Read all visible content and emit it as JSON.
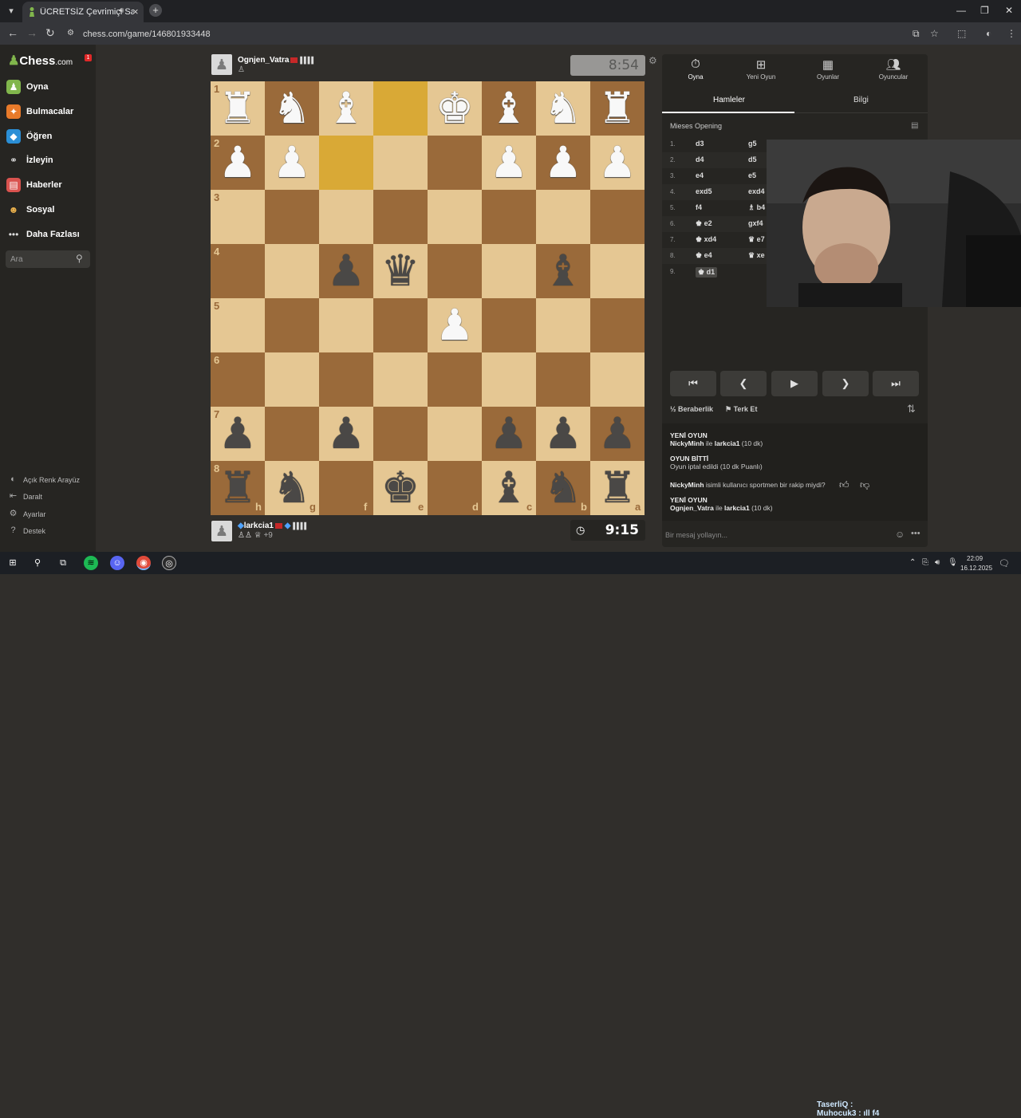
{
  "browser": {
    "tab_title": "ÜCRETSİZ Çevrimiçi Satranç",
    "url": "chess.com/game/146801933448"
  },
  "sidebar": {
    "logo": "Chess",
    "logo_suffix": ".com",
    "notification_count": "1",
    "items": [
      {
        "label": "Oyna",
        "icon": "play-icon"
      },
      {
        "label": "Bulmacalar",
        "icon": "puzzle-icon"
      },
      {
        "label": "Öğren",
        "icon": "learn-icon"
      },
      {
        "label": "İzleyin",
        "icon": "watch-icon"
      },
      {
        "label": "Haberler",
        "icon": "news-icon"
      },
      {
        "label": "Sosyal",
        "icon": "social-icon"
      },
      {
        "label": "Daha Fazlası",
        "icon": "more-icon"
      }
    ],
    "search_placeholder": "Ara",
    "footer": [
      {
        "label": "Açık Renk Arayüz"
      },
      {
        "label": "Daralt"
      },
      {
        "label": "Ayarlar"
      },
      {
        "label": "Destek"
      }
    ]
  },
  "top_player": {
    "name": "Ognjen_Vatra",
    "clock": "8:54"
  },
  "bottom_player": {
    "name": "larkcia1",
    "material": "+9",
    "clock": "9:15"
  },
  "board": {
    "rank_labels": [
      "1",
      "2",
      "3",
      "4",
      "5",
      "6",
      "7",
      "8"
    ],
    "file_labels": [
      "h",
      "g",
      "f",
      "e",
      "d",
      "c",
      "b",
      "a"
    ],
    "highlighted": [
      "r1c4",
      "r2c3"
    ]
  },
  "panel": {
    "tabs": [
      {
        "label": "Oyna",
        "icon": "stopwatch-icon"
      },
      {
        "label": "Yeni Oyun",
        "icon": "plus-icon"
      },
      {
        "label": "Oyunlar",
        "icon": "games-icon"
      },
      {
        "label": "Oyuncular",
        "icon": "players-icon"
      }
    ],
    "subtabs": [
      "Hamleler",
      "Bilgi"
    ],
    "opening": "Mieses Opening",
    "moves": [
      {
        "n": "1.",
        "w": "d3",
        "b": "g5"
      },
      {
        "n": "2.",
        "w": "d4",
        "b": "d5"
      },
      {
        "n": "3.",
        "w": "e4",
        "b": "e5"
      },
      {
        "n": "4.",
        "w": "exd5",
        "b": "exd4"
      },
      {
        "n": "5.",
        "w": "f4",
        "b": "♗ b4"
      },
      {
        "n": "6.",
        "w": "♚ e2",
        "b": "gxf4"
      },
      {
        "n": "7.",
        "w": "♚ xd4",
        "b": "♛ e7"
      },
      {
        "n": "8.",
        "w": "♚ e4",
        "b": "♛ xe"
      },
      {
        "n": "9.",
        "w": "♚ d1",
        "b": ""
      }
    ],
    "draw_label": "Beraberlik",
    "resign_label": "Terk Et",
    "chat": [
      {
        "title": "YENİ OYUN",
        "text_bold": "NickyMinh",
        "text": " ile ",
        "text_bold2": "larkcia1",
        "text_tail": " (10 dk)"
      },
      {
        "title": "OYUN BİTTİ",
        "text": "Oyun iptal edildi (10 dk Puanlı)"
      },
      {
        "text_bold": "NickyMinh",
        "text": " isimli kullanıcı sportmen bir rakip miydi?"
      },
      {
        "title": "YENİ OYUN",
        "text_bold": "Ognjen_Vatra",
        "text": " ile ",
        "text_bold2": "larkcia1",
        "text_tail": " (10 dk)"
      }
    ],
    "chat_placeholder": "Bir mesaj yollayın..."
  },
  "taskbar": {
    "overlay_line1": "TaserliQ :",
    "overlay_line2": "Muhocuk3 : ıll f4",
    "time": "22:09",
    "date": "16.12.2025"
  }
}
